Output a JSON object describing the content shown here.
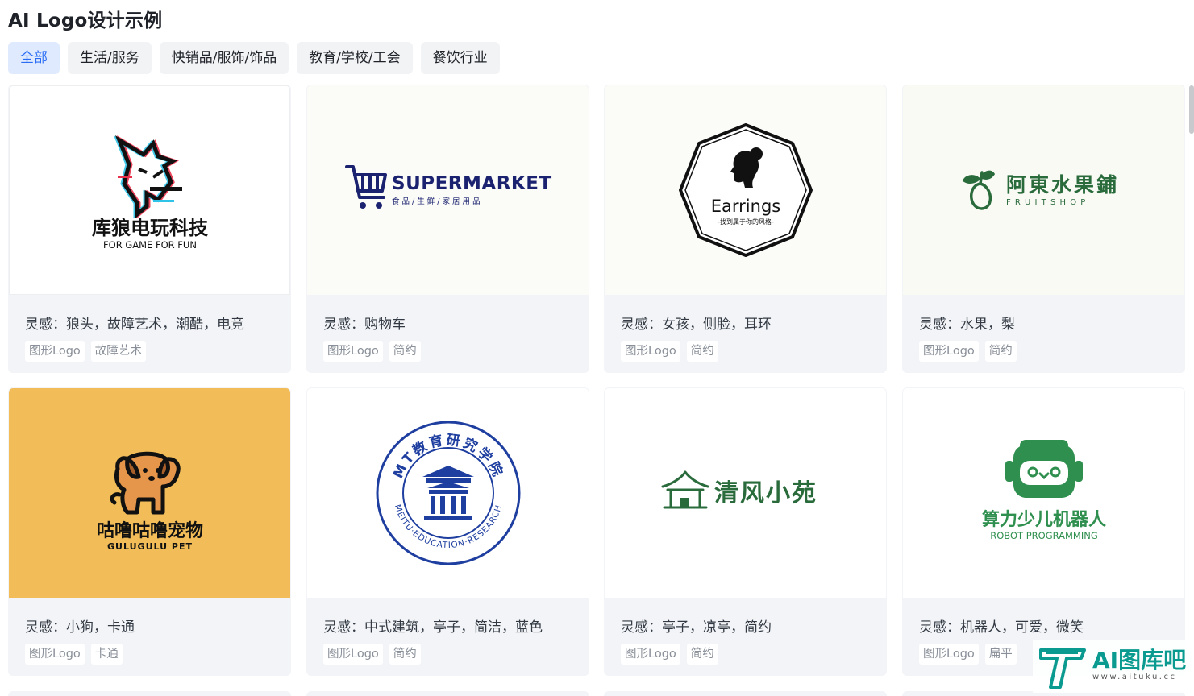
{
  "page": {
    "title": "AI Logo设计示例"
  },
  "tabs": [
    {
      "label": "全部",
      "active": true
    },
    {
      "label": "生活/服务",
      "active": false
    },
    {
      "label": "快销品/服饰/饰品",
      "active": false
    },
    {
      "label": "教育/学校/工会",
      "active": false
    },
    {
      "label": "餐饮行业",
      "active": false
    }
  ],
  "cards": [
    {
      "inspiration": "灵感：狼头，故障艺术，潮酷，电竞",
      "tags": [
        "图形Logo",
        "故障艺术"
      ],
      "logo": {
        "name": "库狼电玩科技",
        "sub": "FOR GAME FOR FUN",
        "bg": "#ffffff"
      }
    },
    {
      "inspiration": "灵感：购物车",
      "tags": [
        "图形Logo",
        "简约"
      ],
      "logo": {
        "name": "SUPERMARKET",
        "sub": "食 品 / 生 鲜 / 家 居 用 品",
        "bg": "#fbfbf8"
      }
    },
    {
      "inspiration": "灵感：女孩，侧脸，耳环",
      "tags": [
        "图形Logo",
        "简约"
      ],
      "logo": {
        "name": "Earrings",
        "sub": "-找到属于你的风格-",
        "bg": "#fbfbf8"
      }
    },
    {
      "inspiration": "灵感：水果，梨",
      "tags": [
        "图形Logo",
        "简约"
      ],
      "logo": {
        "name": "阿東水果鋪",
        "sub": "F R U I T   S H O P",
        "bg": "#fafaf5"
      }
    },
    {
      "inspiration": "灵感：小狗，卡通",
      "tags": [
        "图形Logo",
        "卡通"
      ],
      "logo": {
        "name": "咕噜咕噜宠物",
        "sub": "GULUGULU PET",
        "bg": "#f2bd58"
      }
    },
    {
      "inspiration": "灵感：中式建筑，亭子，简洁，蓝色",
      "tags": [
        "图形Logo",
        "简约"
      ],
      "logo": {
        "name": "MT教育研究学院",
        "sub": "MEITU·EDUCATION·RESEARCH",
        "bg": "#ffffff"
      }
    },
    {
      "inspiration": "灵感：亭子，凉亭，简约",
      "tags": [
        "图形Logo",
        "简约"
      ],
      "logo": {
        "name": "清风小苑",
        "bg": "#ffffff"
      }
    },
    {
      "inspiration": "灵感：机器人，可爱，微笑",
      "tags": [
        "图形Logo",
        "扁平"
      ],
      "logo": {
        "name": "算力少儿机器人",
        "sub": "ROBOT PROGRAMMING",
        "bg": "#ffffff"
      }
    }
  ],
  "watermark": {
    "title": "AI图库吧",
    "url": "www.aituku.cc"
  },
  "colors": {
    "accent": "#2a6df4",
    "tab_active_bg": "#dfeafe",
    "card_bg": "#f2f4f7",
    "tag_text": "#8a9099",
    "edu_blue": "#1f3fa0",
    "green": "#2a6b3c",
    "robot_green": "#2f8f4e"
  }
}
